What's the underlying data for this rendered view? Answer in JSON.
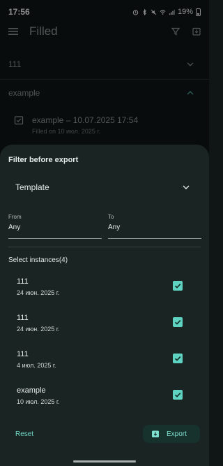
{
  "status_bar": {
    "time": "17:56",
    "battery": "19%",
    "icons": [
      "alarm-icon",
      "bluetooth-icon",
      "mute-icon",
      "wifi-icon",
      "signal-icon",
      "battery-icon"
    ]
  },
  "app_bar": {
    "title": "Filled",
    "icons": [
      "menu-icon",
      "filter-icon",
      "export-box-icon"
    ]
  },
  "background_list": {
    "groups": [
      {
        "label": "111",
        "expanded": false
      },
      {
        "label": "example",
        "expanded": true
      }
    ],
    "item": {
      "title": "example – 10.07.2025 17:54",
      "subtitle": "Filled on 10 июл. 2025 г."
    }
  },
  "sheet": {
    "title": "Filter before export",
    "template_label": "Template",
    "from": {
      "label": "From",
      "value": "Any"
    },
    "to": {
      "label": "To",
      "value": "Any"
    },
    "select_title": "Select instances(4)",
    "instances": [
      {
        "name": "111",
        "date": "24 июн. 2025 г.",
        "checked": true
      },
      {
        "name": "111",
        "date": "24 июн. 2025 г.",
        "checked": true
      },
      {
        "name": "111",
        "date": "4 июл. 2025 г.",
        "checked": true
      },
      {
        "name": "example",
        "date": "10 июл. 2025 г.",
        "checked": true
      }
    ],
    "reset_label": "Reset",
    "export_label": "Export"
  },
  "colors": {
    "accent": "#5ed3c1",
    "sheet_bg": "#1a2423",
    "page_bg": "#101615"
  }
}
